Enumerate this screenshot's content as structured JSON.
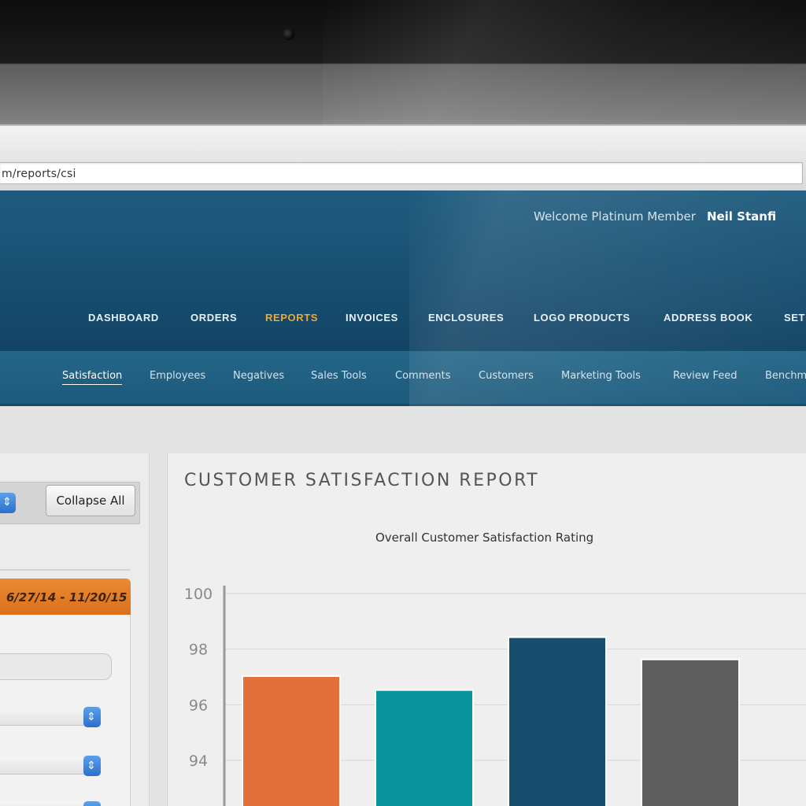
{
  "browser": {
    "url": "m/reports/csi"
  },
  "header": {
    "welcome_text": "Welcome Platinum Member",
    "user_name": "Neil Stanfi"
  },
  "main_nav": {
    "items": [
      {
        "label": "DASHBOARD"
      },
      {
        "label": "ORDERS"
      },
      {
        "label": "REPORTS",
        "active": true
      },
      {
        "label": "INVOICES"
      },
      {
        "label": "ENCLOSURES"
      },
      {
        "label": "LOGO PRODUCTS"
      },
      {
        "label": "ADDRESS BOOK"
      },
      {
        "label": "SET"
      }
    ]
  },
  "sub_nav": {
    "items": [
      {
        "label": "Satisfaction",
        "active": true
      },
      {
        "label": "Employees"
      },
      {
        "label": "Negatives"
      },
      {
        "label": "Sales Tools"
      },
      {
        "label": "Comments"
      },
      {
        "label": "Customers"
      },
      {
        "label": "Marketing Tools"
      },
      {
        "label": "Review Feed"
      },
      {
        "label": "Benchm"
      }
    ]
  },
  "left_panel": {
    "collapse_label": "Collapse All",
    "date_range": "6/27/14 - 11/20/15"
  },
  "report": {
    "title": "CUSTOMER SATISFACTION REPORT"
  },
  "chart_data": {
    "type": "bar",
    "title": "Overall Customer Satisfaction Rating",
    "xlabel": "",
    "ylabel": "",
    "yticks": [
      "100",
      "98",
      "96",
      "94"
    ],
    "ylim": [
      92,
      100
    ],
    "grid": true,
    "values": [
      97.0,
      96.5,
      98.4,
      97.6
    ],
    "colors": [
      "#e1703a",
      "#0a949b",
      "#174e6e",
      "#5f5f5f"
    ]
  },
  "colors": {
    "header_blue": "#184f71",
    "active_nav": "#f0a835",
    "date_tab": "#e07a28"
  }
}
